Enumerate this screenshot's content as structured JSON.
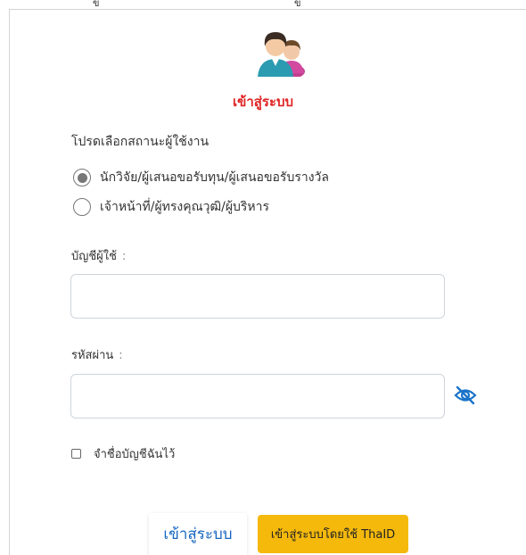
{
  "header": {
    "title": "เข้าสู่ระบบ",
    "top_marks": [
      "ข",
      "ข"
    ]
  },
  "user_type": {
    "prompt": "โปรดเลือกสถานะผู้ใช้งาน",
    "options": [
      {
        "label": "นักวิจัย/ผู้เสนอขอรับทุน/ผู้เสนอขอรับรางวัล",
        "selected": true
      },
      {
        "label": "เจ้าหน้าที่/ผู้ทรงคุณวุฒิ/ผู้บริหาร",
        "selected": false
      }
    ]
  },
  "username": {
    "label": "บัญชีผู้ใช้",
    "colon": ":",
    "value": "",
    "placeholder": ""
  },
  "password": {
    "label": "รหัสผ่าน",
    "colon": ":",
    "value": "",
    "placeholder": ""
  },
  "remember": {
    "label": "จำชื่อบัญชีฉันไว้",
    "checked": false
  },
  "buttons": {
    "login": "เข้าสู่ระบบ",
    "thaid": "เข้าสู่ระบบโดยใช้ ThaID"
  },
  "colors": {
    "title": "#e02424",
    "login_text": "#1565c0",
    "thaid_bg": "#f5b90c",
    "eye_icon": "#1a73c9"
  },
  "icons": {
    "avatar": "users-avatar-icon",
    "password_toggle": "eye-slash-icon"
  }
}
